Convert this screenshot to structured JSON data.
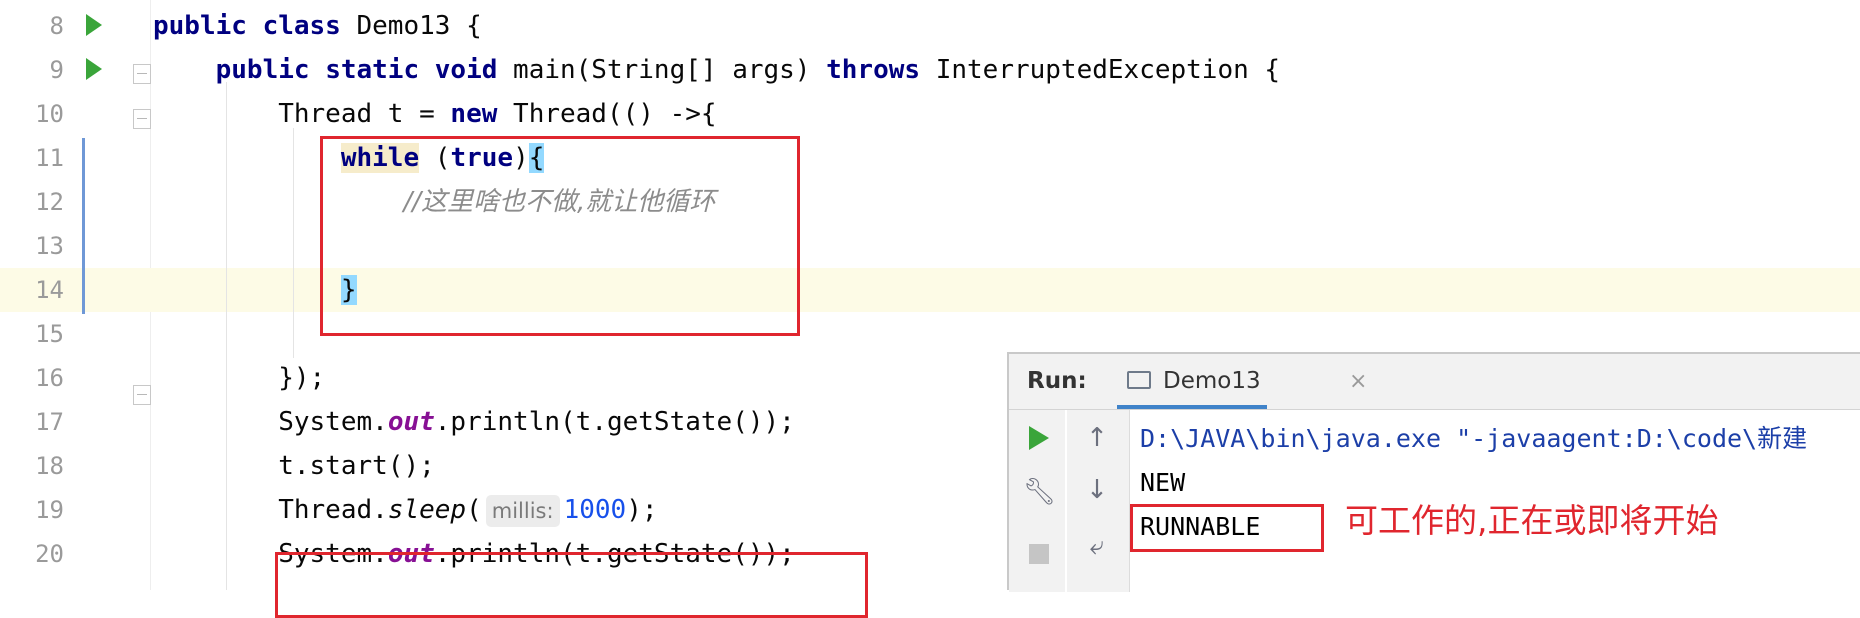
{
  "editor": {
    "lines": [
      {
        "num": "8",
        "parts": [
          [
            "kw",
            "public class"
          ],
          [
            "t",
            " Demo13 {"
          ]
        ]
      },
      {
        "num": "9",
        "parts": [
          [
            "t",
            "    "
          ],
          [
            "kw",
            "public static void"
          ],
          [
            "t",
            " main(String[] args) "
          ],
          [
            "kw",
            "throws"
          ],
          [
            "t",
            " InterruptedException {"
          ]
        ]
      },
      {
        "num": "10",
        "parts": [
          [
            "t",
            "        Thread t = "
          ],
          [
            "kw",
            "new"
          ],
          [
            "t",
            " Thread(() ->{"
          ]
        ]
      },
      {
        "num": "11",
        "parts": [
          [
            "t",
            "            "
          ],
          [
            "kwhl",
            "while"
          ],
          [
            "t",
            " ("
          ],
          [
            "kw",
            "true"
          ],
          [
            "t",
            ")"
          ],
          [
            "brace",
            "{"
          ]
        ]
      },
      {
        "num": "12",
        "parts": [
          [
            "t",
            "                "
          ],
          [
            "comment",
            "//这里啥也不做,就让他循环"
          ]
        ]
      },
      {
        "num": "13",
        "parts": []
      },
      {
        "num": "14",
        "parts": [
          [
            "t",
            "            "
          ],
          [
            "brace",
            "}"
          ]
        ]
      },
      {
        "num": "15",
        "parts": []
      },
      {
        "num": "16",
        "parts": [
          [
            "t",
            "        });"
          ]
        ]
      },
      {
        "num": "17",
        "parts": [
          [
            "t",
            "        System."
          ],
          [
            "field",
            "out"
          ],
          [
            "t",
            ".println(t.getState());"
          ]
        ]
      },
      {
        "num": "18",
        "parts": [
          [
            "t",
            "        t.start();"
          ]
        ]
      },
      {
        "num": "19",
        "parts": [
          [
            "t",
            "        Thread."
          ],
          [
            "italic",
            "sleep"
          ],
          [
            "t",
            "("
          ],
          [
            "hint",
            "millis:"
          ],
          [
            "num",
            "1000"
          ],
          [
            "t",
            ");"
          ]
        ]
      },
      {
        "num": "20",
        "parts": [
          [
            "t",
            "        System."
          ],
          [
            "field",
            "out"
          ],
          [
            "t",
            ".println(t.getState());"
          ]
        ]
      }
    ]
  },
  "run_panel": {
    "title": "Run:",
    "tab_label": "Demo13",
    "tab_close": "×",
    "console_lines": [
      "D:\\JAVA\\bin\\java.exe \"-javaagent:D:\\code\\新建",
      "NEW",
      "RUNNABLE"
    ]
  },
  "annotation": "可工作的,正在或即将开始",
  "icons": [
    "run-gutter-icon",
    "fold-icon",
    "play-icon",
    "wrench-icon",
    "stop-icon",
    "up-arrow-icon",
    "down-arrow-icon",
    "soft-wrap-icon"
  ]
}
